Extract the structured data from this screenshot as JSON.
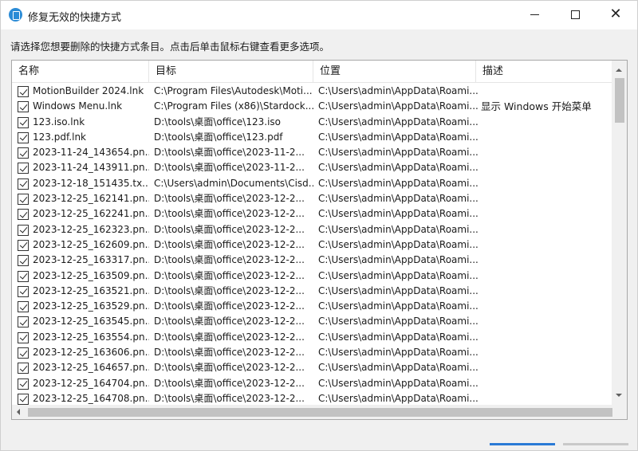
{
  "window": {
    "title": "修复无效的快捷方式",
    "instruction": "请选择您想要删除的快捷方式条目。点击后单击鼠标右键查看更多选项。"
  },
  "columns": [
    "名称",
    "目标",
    "位置",
    "描述"
  ],
  "rows": [
    {
      "name": "MotionBuilder 2024.lnk",
      "target": "C:\\Program Files\\Autodesk\\Moti...",
      "location": "C:\\Users\\admin\\AppData\\Roami...",
      "description": ""
    },
    {
      "name": "Windows Menu.lnk",
      "target": "C:\\Program Files (x86)\\Stardock...",
      "location": "C:\\Users\\admin\\AppData\\Roami...",
      "description": "显示 Windows 开始菜单"
    },
    {
      "name": "123.iso.lnk",
      "target": "D:\\tools\\桌面\\office\\123.iso",
      "location": "C:\\Users\\admin\\AppData\\Roami...",
      "description": ""
    },
    {
      "name": "123.pdf.lnk",
      "target": "D:\\tools\\桌面\\office\\123.pdf",
      "location": "C:\\Users\\admin\\AppData\\Roami...",
      "description": ""
    },
    {
      "name": "2023-11-24_143654.pn...",
      "target": "D:\\tools\\桌面\\office\\2023-11-2...",
      "location": "C:\\Users\\admin\\AppData\\Roami...",
      "description": ""
    },
    {
      "name": "2023-11-24_143911.pn...",
      "target": "D:\\tools\\桌面\\office\\2023-11-2...",
      "location": "C:\\Users\\admin\\AppData\\Roami...",
      "description": ""
    },
    {
      "name": "2023-12-18_151435.tx...",
      "target": "C:\\Users\\admin\\Documents\\Cisd...",
      "location": "C:\\Users\\admin\\AppData\\Roami...",
      "description": ""
    },
    {
      "name": "2023-12-25_162141.pn...",
      "target": "D:\\tools\\桌面\\office\\2023-12-2...",
      "location": "C:\\Users\\admin\\AppData\\Roami...",
      "description": ""
    },
    {
      "name": "2023-12-25_162241.pn...",
      "target": "D:\\tools\\桌面\\office\\2023-12-2...",
      "location": "C:\\Users\\admin\\AppData\\Roami...",
      "description": ""
    },
    {
      "name": "2023-12-25_162323.pn...",
      "target": "D:\\tools\\桌面\\office\\2023-12-2...",
      "location": "C:\\Users\\admin\\AppData\\Roami...",
      "description": ""
    },
    {
      "name": "2023-12-25_162609.pn...",
      "target": "D:\\tools\\桌面\\office\\2023-12-2...",
      "location": "C:\\Users\\admin\\AppData\\Roami...",
      "description": ""
    },
    {
      "name": "2023-12-25_163317.pn...",
      "target": "D:\\tools\\桌面\\office\\2023-12-2...",
      "location": "C:\\Users\\admin\\AppData\\Roami...",
      "description": ""
    },
    {
      "name": "2023-12-25_163509.pn...",
      "target": "D:\\tools\\桌面\\office\\2023-12-2...",
      "location": "C:\\Users\\admin\\AppData\\Roami...",
      "description": ""
    },
    {
      "name": "2023-12-25_163521.pn...",
      "target": "D:\\tools\\桌面\\office\\2023-12-2...",
      "location": "C:\\Users\\admin\\AppData\\Roami...",
      "description": ""
    },
    {
      "name": "2023-12-25_163529.pn...",
      "target": "D:\\tools\\桌面\\office\\2023-12-2...",
      "location": "C:\\Users\\admin\\AppData\\Roami...",
      "description": ""
    },
    {
      "name": "2023-12-25_163545.pn...",
      "target": "D:\\tools\\桌面\\office\\2023-12-2...",
      "location": "C:\\Users\\admin\\AppData\\Roami...",
      "description": ""
    },
    {
      "name": "2023-12-25_163554.pn...",
      "target": "D:\\tools\\桌面\\office\\2023-12-2...",
      "location": "C:\\Users\\admin\\AppData\\Roami...",
      "description": ""
    },
    {
      "name": "2023-12-25_163606.pn...",
      "target": "D:\\tools\\桌面\\office\\2023-12-2...",
      "location": "C:\\Users\\admin\\AppData\\Roami...",
      "description": ""
    },
    {
      "name": "2023-12-25_164657.pn...",
      "target": "D:\\tools\\桌面\\office\\2023-12-2...",
      "location": "C:\\Users\\admin\\AppData\\Roami...",
      "description": ""
    },
    {
      "name": "2023-12-25_164704.pn...",
      "target": "D:\\tools\\桌面\\office\\2023-12-2...",
      "location": "C:\\Users\\admin\\AppData\\Roami...",
      "description": ""
    },
    {
      "name": "2023-12-25_164708.pn...",
      "target": "D:\\tools\\桌面\\office\\2023-12-2...",
      "location": "C:\\Users\\admin\\AppData\\Roami...",
      "description": ""
    }
  ],
  "icons": {
    "app": "shortcut-repair-icon",
    "minimize": "minimize-icon",
    "maximize": "maximize-icon",
    "close": "close-icon",
    "checkbox": "checkbox-checked-icon"
  },
  "colors": {
    "accent": "#2a7ad6",
    "title_bar": "#ffffff",
    "window_bg": "#f0f0f0"
  }
}
